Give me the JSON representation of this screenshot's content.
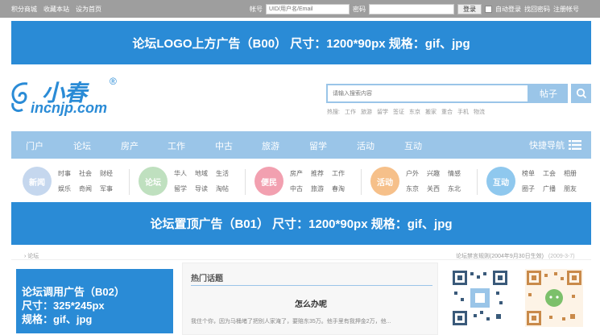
{
  "topbar": {
    "links": [
      "积分商城",
      "收藏本站",
      "设为首页"
    ],
    "account_label": "帐号",
    "account_placeholder": "UID/用户名/Email",
    "password_label": "密码",
    "login_label": "登录",
    "auto_login_label": "自动登录",
    "forgot_label": "找回密码",
    "register_label": "注册帐号"
  },
  "ad_b00": "论坛LOGO上方广告（B00） 尺寸：1200*90px 规格：gif、jpg",
  "logo": {
    "cn": "小春",
    "en": "incnjp.com",
    "reg": "®"
  },
  "search": {
    "placeholder": "请输入搜索内容",
    "button_label": "帖子"
  },
  "hot": {
    "label": "热搜:",
    "words": [
      "工作",
      "旅游",
      "留学",
      "签证",
      "东京",
      "搬家",
      "重合",
      "手机",
      "物流"
    ]
  },
  "nav": {
    "items": [
      "门户",
      "论坛",
      "房产",
      "工作",
      "中古",
      "旅游",
      "留学",
      "活动",
      "互动"
    ],
    "quick_label": "快捷导航"
  },
  "categories": [
    {
      "name": "新闻",
      "color": "#c5d7ee",
      "links": [
        "时事",
        "社会",
        "财经",
        "娱乐",
        "奇闻",
        "军事"
      ]
    },
    {
      "name": "论坛",
      "color": "#bfe0bf",
      "links": [
        "华人",
        "地域",
        "生活",
        "留学",
        "导读",
        "淘帖"
      ]
    },
    {
      "name": "便民",
      "color": "#f2a0b0",
      "links": [
        "房产",
        "推荐",
        "工作",
        "中古",
        "旅游",
        "春淘"
      ]
    },
    {
      "name": "活动",
      "color": "#f6c08a",
      "links": [
        "户外",
        "兴趣",
        "情感",
        "东京",
        "关西",
        "东北"
      ]
    },
    {
      "name": "互动",
      "color": "#8fc8ee",
      "links": [
        "榜单",
        "工会",
        "相册",
        "圈子",
        "广播",
        "朋友"
      ]
    }
  ],
  "ad_b01": "论坛置顶广告（B01） 尺寸：1200*90px 规格：gif、jpg",
  "breadcrumb": "› 论坛",
  "rules": {
    "text": "论坛禁言规则(2004年9月30日生效)",
    "date": "(2009-3-7)"
  },
  "ad_b02": {
    "line1": "论坛调用广告（B02）",
    "line2": "尺寸：325*245px",
    "line3": "规格：gif、jpg"
  },
  "hot_topics": {
    "title": "热门话题",
    "question": "怎么办呢",
    "desc": "我住个你，因为马桶堵了把别人家淹了，要赔东35万。他手里有我押金2万，他..."
  }
}
